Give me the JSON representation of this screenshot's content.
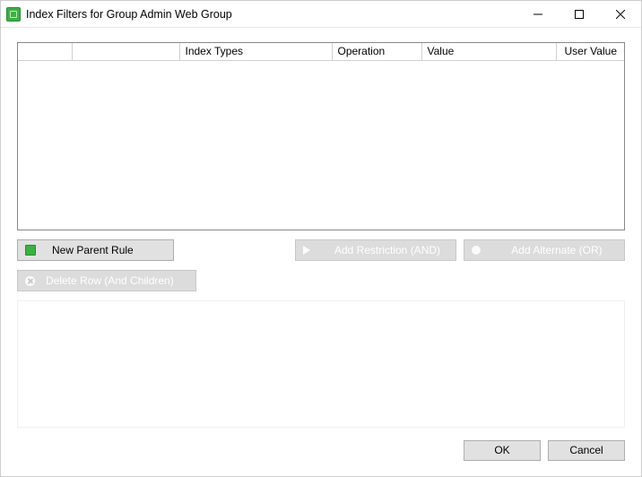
{
  "window": {
    "title": "Index Filters for Group Admin Web Group"
  },
  "grid": {
    "columns": {
      "c0": "",
      "c1": "",
      "c2": "Index Types",
      "c3": "Operation",
      "c4": "Value",
      "c5": "User Value"
    }
  },
  "toolbar": {
    "new_parent_rule": "New Parent Rule",
    "add_restriction": "Add Restriction (AND)",
    "add_alternate": "Add Alternate (OR)",
    "delete_row": "Delete Row (And Children)"
  },
  "footer": {
    "ok": "OK",
    "cancel": "Cancel"
  }
}
